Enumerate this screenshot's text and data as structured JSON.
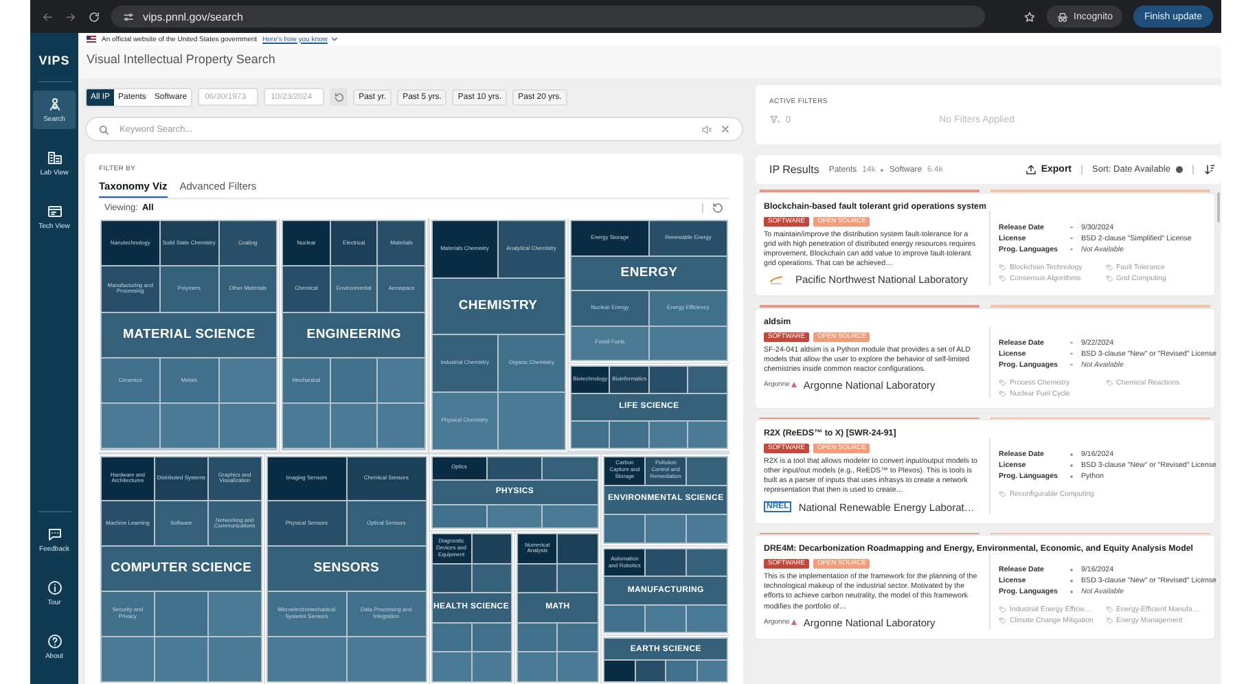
{
  "browser": {
    "url": "vips.pnnl.gov/search",
    "profile": "Incognito",
    "update_button": "Finish update"
  },
  "banner": {
    "text": "An official website of the United States government",
    "link": "Here's how you know"
  },
  "sidebar": {
    "logo": "VIPS",
    "items": [
      {
        "label": "Search",
        "selected": true
      },
      {
        "label": "Lab View",
        "selected": false
      },
      {
        "label": "Tech View",
        "selected": false
      }
    ],
    "footer_items": [
      {
        "label": "Feedback"
      },
      {
        "label": "Tour"
      },
      {
        "label": "About"
      }
    ]
  },
  "page_title": "Visual Intellectual Property Search",
  "ip_types": [
    {
      "label": "All IP",
      "selected": true
    },
    {
      "label": "Patents",
      "selected": false
    },
    {
      "label": "Software",
      "selected": false
    }
  ],
  "date_range": {
    "from": {
      "placeholder": "06/30/1973"
    },
    "to": {
      "placeholder": "10/23/2024"
    }
  },
  "quick_ranges": [
    "Past yr.",
    "Past 5 yrs.",
    "Past 10 yrs.",
    "Past 20 yrs."
  ],
  "search": {
    "placeholder": "Keyword Search..."
  },
  "active_filters": {
    "heading": "ACTIVE FILTERS",
    "count": "0",
    "empty_text": "No Filters Applied"
  },
  "filter_panel": {
    "heading": "FILTER BY",
    "tabs": [
      {
        "label": "Taxonomy Viz",
        "selected": true
      },
      {
        "label": "Advanced Filters",
        "selected": false
      }
    ],
    "viewing_label": "Viewing:",
    "viewing_value": "All",
    "taxonomy": [
      {
        "label": "MATERIAL SCIENCE",
        "children": [
          {
            "label": "Nanotechnology"
          },
          {
            "label": "Solid State Chemistry"
          },
          {
            "label": "Coating"
          },
          {
            "label": "Manufacturing and Processing"
          },
          {
            "label": "Polymers"
          },
          {
            "label": "Other Materials"
          },
          {
            "label": "Ceramics"
          },
          {
            "label": "Metals"
          }
        ]
      },
      {
        "label": "ENGINEERING",
        "children": [
          {
            "label": "Nuclear"
          },
          {
            "label": "Electrical"
          },
          {
            "label": "Materials"
          },
          {
            "label": "Chemical"
          },
          {
            "label": "Environmental"
          },
          {
            "label": "Aerospace"
          },
          {
            "label": "Mechanical"
          }
        ]
      },
      {
        "label": "CHEMISTRY",
        "children": [
          {
            "label": "Materials Chemistry"
          },
          {
            "label": "Analytical Chemistry"
          },
          {
            "label": "Industrial Chemistry"
          },
          {
            "label": "Organic Chemistry"
          },
          {
            "label": "Physical Chemistry"
          }
        ]
      },
      {
        "label": "ENERGY",
        "children": [
          {
            "label": "Energy Storage"
          },
          {
            "label": "Renewable Energy"
          },
          {
            "label": "Nuclear Energy"
          },
          {
            "label": "Energy Efficiency"
          },
          {
            "label": "Fossil Fuels"
          }
        ]
      },
      {
        "label": "LIFE SCIENCE",
        "children": [
          {
            "label": "Biotechnology"
          },
          {
            "label": "Bioinformatics"
          }
        ]
      },
      {
        "label": "COMPUTER SCIENCE",
        "children": [
          {
            "label": "Hardware and Architectures"
          },
          {
            "label": "Distributed Systems"
          },
          {
            "label": "Graphics and Visualization"
          },
          {
            "label": "Machine Learning"
          },
          {
            "label": "Software"
          },
          {
            "label": "Networking and Communications"
          },
          {
            "label": "Security and Privacy"
          }
        ]
      },
      {
        "label": "SENSORS",
        "children": [
          {
            "label": "Imaging Sensors"
          },
          {
            "label": "Chemical Sensors"
          },
          {
            "label": "Physical Sensors"
          },
          {
            "label": "Optical Sensors"
          },
          {
            "label": "Microelectromechanical Systems Sensors"
          },
          {
            "label": "Data Processing and Integration"
          }
        ]
      },
      {
        "label": "PHYSICS",
        "children": [
          {
            "label": "Optics"
          }
        ]
      },
      {
        "label": "HEALTH SCIENCE",
        "children": [
          {
            "label": "Diagnostic Devices and Equipment"
          }
        ]
      },
      {
        "label": "MATH",
        "children": [
          {
            "label": "Numerical Analysis"
          }
        ]
      },
      {
        "label": "ENVIRONMENTAL SCIENCE",
        "children": [
          {
            "label": "Carbon Capture and Storage"
          },
          {
            "label": "Pollution Control and Remediation"
          }
        ]
      },
      {
        "label": "MANUFACTURING",
        "children": [
          {
            "label": "Automation and Robotics"
          }
        ]
      },
      {
        "label": "EARTH SCIENCE"
      }
    ]
  },
  "results": {
    "heading": "IP Results",
    "counts": [
      {
        "label": "Patents",
        "value": "14k"
      },
      {
        "label": "Software",
        "value": "6.4k"
      }
    ],
    "export": "Export",
    "sort": "Sort: Date Available",
    "items": [
      {
        "title": "Blockchain-based fault tolerant grid operations system",
        "tags": [
          {
            "label": "SOFTWARE",
            "kind": "type"
          },
          {
            "label": "OPEN SOURCE",
            "kind": "license"
          }
        ],
        "description": "To maintain/improve the distribution system fault-tolerance for a grid with high penetration of distributed energy resources requires improvement, Blockchain can add value to improve fault-tolerant grid operations. That can be achieved…",
        "lab": "Pacific Northwest National Laboratory",
        "lab_logo": {
          "kind": "swoosh"
        },
        "details": [
          {
            "label": "Release Date",
            "value": "9/30/2024",
            "missing": false
          },
          {
            "label": "License",
            "value": "BSD 2-clause \"Simplified\" License",
            "missing": false
          },
          {
            "label": "Prog. Languages",
            "value": "Not Available",
            "missing": true
          }
        ],
        "keywords": [
          "Blockchain Technology",
          "Fault Tolerance",
          "Consensus Algorithms",
          "Grid Computing"
        ]
      },
      {
        "title": "aldsim",
        "tags": [
          {
            "label": "SOFTWARE",
            "kind": "type"
          },
          {
            "label": "OPEN SOURCE",
            "kind": "license"
          }
        ],
        "description": "SF-24-041 aldsim is a Python module that provides a set of ALD models that allow the user to explore the behavior of self-limited chemistries inside common reactor configurations.",
        "lab": "Argonne National Laboratory",
        "lab_logo": {
          "kind": "wordmark",
          "text": "Argonne"
        },
        "details": [
          {
            "label": "Release Date",
            "value": "9/22/2024",
            "missing": false
          },
          {
            "label": "License",
            "value": "BSD 3-clause \"New\" or \"Revised\" License",
            "missing": false
          },
          {
            "label": "Prog. Languages",
            "value": "Not Available",
            "missing": true
          }
        ],
        "keywords": [
          "Process Chemistry",
          "Chemical Reactions",
          "Nuclear Fuel Cycle"
        ]
      },
      {
        "title": "R2X (ReEDS™ to X) [SWR-24-91]",
        "tags": [
          {
            "label": "SOFTWARE",
            "kind": "type"
          },
          {
            "label": "OPEN SOURCE",
            "kind": "license"
          }
        ],
        "description": "R2X is a tool that allows modeler to convert input/output models to other input/out models (e.g., ReEDS™ to Plexos). This is tools is built as a parser of inputs that uses infrasys to create a network representation that then is used to create…",
        "lab": "National Renewable Energy Laborat…",
        "lab_logo": {
          "kind": "boxed",
          "text": "NREL"
        },
        "details": [
          {
            "label": "Release Date",
            "value": "9/16/2024",
            "missing": false
          },
          {
            "label": "License",
            "value": "BSD 3-clause \"New\" or \"Revised\" License",
            "missing": false
          },
          {
            "label": "Prog. Languages",
            "value": "Python",
            "missing": false
          }
        ],
        "keywords": [
          "Reconfigurable Computing"
        ]
      },
      {
        "title": "DRE4M: Decarbonization Roadmapping and Energy, Environmental, Economic, and Equity Analysis Model",
        "tags": [
          {
            "label": "SOFTWARE",
            "kind": "type"
          },
          {
            "label": "OPEN SOURCE",
            "kind": "license"
          }
        ],
        "description": "This is the implementation of the framework for the planning of the technological makeup of the industrial sector. Motivated by the efforts to achieve carbon neutrality, the model of this framework modifies the portfolio of…",
        "lab": "Argonne National Laboratory",
        "lab_logo": {
          "kind": "wordmark",
          "text": "Argonne"
        },
        "details": [
          {
            "label": "Release Date",
            "value": "9/16/2024",
            "missing": false
          },
          {
            "label": "License",
            "value": "BSD 3-clause \"New\" or \"Revised\" License",
            "missing": false
          },
          {
            "label": "Prog. Languages",
            "value": "Not Available",
            "missing": true
          }
        ],
        "keywords": [
          "Industrial Energy Efficie…",
          "Energy-Efficient Manufa…",
          "Climate Change Mitigation",
          "Energy Management"
        ]
      }
    ]
  }
}
